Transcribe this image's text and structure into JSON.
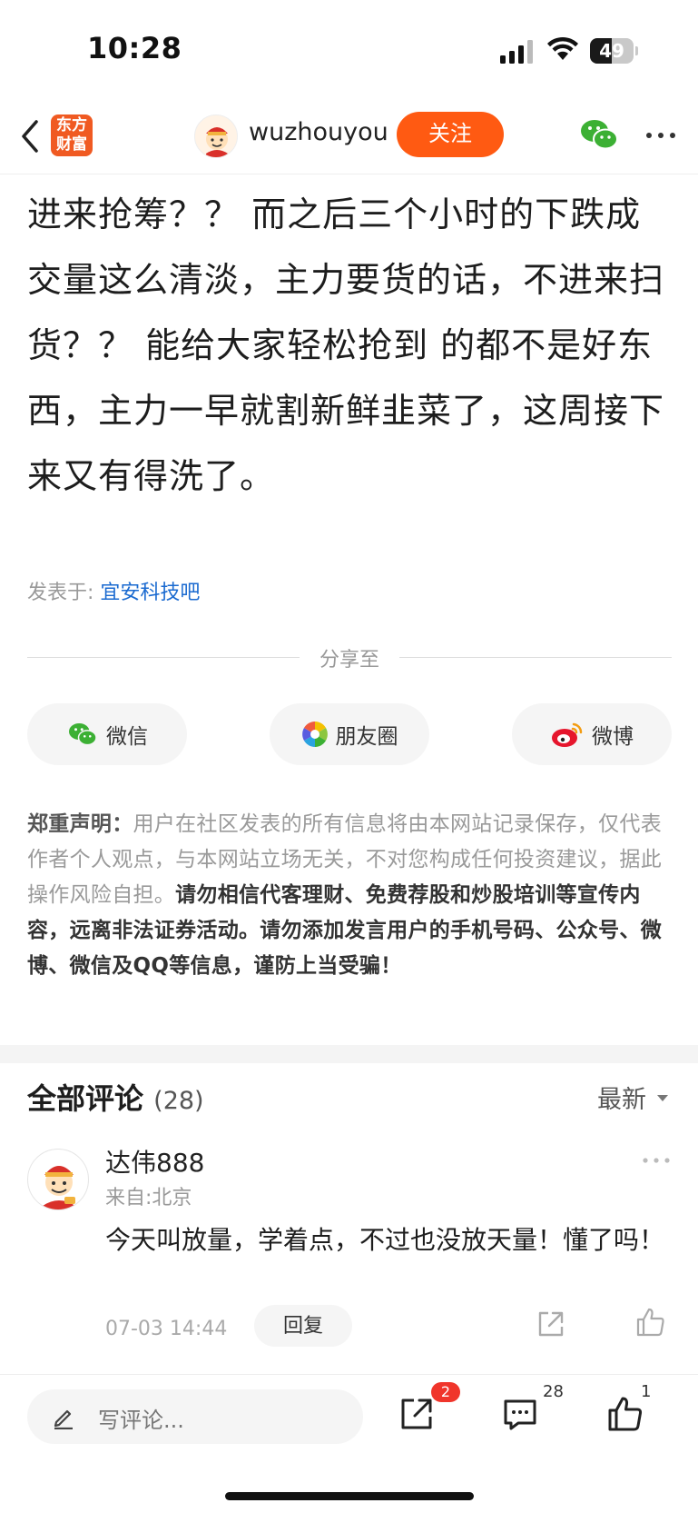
{
  "status_bar": {
    "time": "10:28",
    "battery": "49",
    "battery_level": 0.49
  },
  "nav": {
    "logo_line1": "东方",
    "logo_line2": "财富",
    "username": "wuzhouyou",
    "follow_label": "关注"
  },
  "article": {
    "text": "进来抢筹？？ 而之后三个小时的下跌成交量这么清淡，主力要货的话，不进来扫货？？ 能给大家轻松抢到 的都不是好东西，主力一早就割新鲜韭菜了，这周接下来又有得洗了。",
    "posted_prefix": "发表于: ",
    "posted_bar": "宜安科技吧"
  },
  "share": {
    "divider_label": "分享至",
    "buttons": [
      {
        "label": "微信",
        "icon": "wechat-icon"
      },
      {
        "label": "朋友圈",
        "icon": "moments-icon"
      },
      {
        "label": "微博",
        "icon": "weibo-icon"
      }
    ]
  },
  "disclaimer": {
    "head": "郑重声明：",
    "normal": "用户在社区发表的所有信息将由本网站记录保存，仅代表作者个人观点，与本网站立场无关，不对您构成任何投资建议，据此操作风险自担。",
    "strong": "请勿相信代客理财、免费荐股和炒股培训等宣传内容，远离非法证券活动。请勿添加发言用户的手机号码、公众号、微博、微信及QQ等信息，谨防上当受骗！"
  },
  "comments": {
    "title": "全部评论",
    "count": "(28)",
    "sort_label": "最新",
    "items": [
      {
        "name": "达伟888",
        "location": "来自:北京",
        "content": "今天叫放量，学着点，不过也没放天量！懂了吗！",
        "time": "07-03 14:44",
        "reply_label": "回复"
      }
    ]
  },
  "bottom_bar": {
    "placeholder": "写评论...",
    "share_badge": "2",
    "comment_count": "28",
    "like_count": "1"
  }
}
